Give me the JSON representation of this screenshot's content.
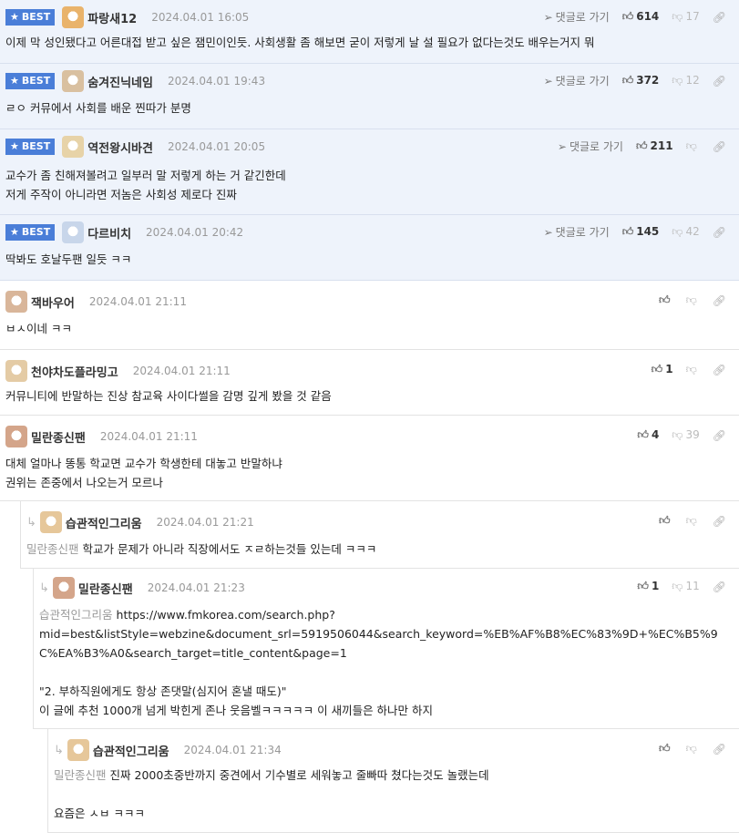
{
  "actions": {
    "reply_label": "댓글로 가기",
    "best_label": "BEST"
  },
  "comments": [
    {
      "best": true,
      "nick": "파랑새12",
      "date": "2024.04.01 16:05",
      "up": "614",
      "down": "17",
      "text": "이제 막 성인됐다고 어른대접 받고 싶은 잼민이인듯. 사회생활 좀 해보면 굳이 저렇게 날 설 필요가 없다는것도 배우는거지 뭐",
      "mention": ""
    },
    {
      "best": true,
      "nick": "숨겨진닉네임",
      "date": "2024.04.01 19:43",
      "up": "372",
      "down": "12",
      "text": "ㄹㅇ 커뮤에서 사회를 배운 찐따가 분명",
      "mention": ""
    },
    {
      "best": true,
      "nick": "역전왕시바견",
      "date": "2024.04.01 20:05",
      "up": "211",
      "down": "",
      "text": "교수가 좀 친해져볼려고 일부러 말 저렇게 하는 거 같긴한데\n저게 주작이 아니라면 저놈은 사회성 제로다 진짜",
      "mention": ""
    },
    {
      "best": true,
      "nick": "다르비치",
      "date": "2024.04.01 20:42",
      "up": "145",
      "down": "42",
      "text": "딱봐도 호날두팬 일듯 ㅋㅋ",
      "mention": ""
    },
    {
      "best": false,
      "nick": "잭바우어",
      "date": "2024.04.01 21:11",
      "up": "",
      "down": "",
      "text": "ㅂㅅ이네 ㅋㅋ",
      "mention": ""
    },
    {
      "best": false,
      "nick": "천야차도플라밍고",
      "date": "2024.04.01 21:11",
      "up": "1",
      "down": "",
      "text": "커뮤니티에 반말하는 진상 참교육 사이다썰을 감명 깊게 봤을 것 같음",
      "mention": ""
    },
    {
      "best": false,
      "nick": "밀란종신팬",
      "date": "2024.04.01 21:11",
      "up": "4",
      "down": "39",
      "text": "대체 얼마나 똥통 학교면 교수가 학생한테 대놓고 반말하냐\n권위는 존중에서 나오는거 모르나",
      "mention": ""
    },
    {
      "best": false,
      "nick": "습관적인그리움",
      "date": "2024.04.01 21:21",
      "up": "",
      "down": "",
      "text": "학교가 문제가 아니라 직장에서도 ㅈㄹ하는것들 있는데 ㅋㅋㅋ",
      "mention": "밀란종신팬"
    },
    {
      "best": false,
      "nick": "밀란종신팬",
      "date": "2024.04.01 21:23",
      "up": "1",
      "down": "11",
      "text": "https://www.fmkorea.com/search.php?\nmid=best&listStyle=webzine&document_srl=5919506044&search_keyword=%EB%AF%B8%EC%83%9D+%EC%B5%9C%EA%B3%A0&search_target=title_content&page=1\n\n\"2. 부하직원에게도 항상 존댓말(심지어 혼낼 때도)\"\n이 글에 추천 1000개 넘게 박힌게 존나 웃음벨ㅋㅋㅋㅋㅋ 이 새끼들은 하나만 하지",
      "mention": "습관적인그리움"
    },
    {
      "best": false,
      "nick": "습관적인그리움",
      "date": "2024.04.01 21:34",
      "up": "",
      "down": "",
      "text": "진짜 2000초중반까지 중견에서 기수별로 세워놓고 줄빠따 쳤다는것도 놀랬는데\n\n요즘은 ㅅㅂ ㅋㅋㅋ",
      "mention": "밀란종신팬"
    }
  ]
}
